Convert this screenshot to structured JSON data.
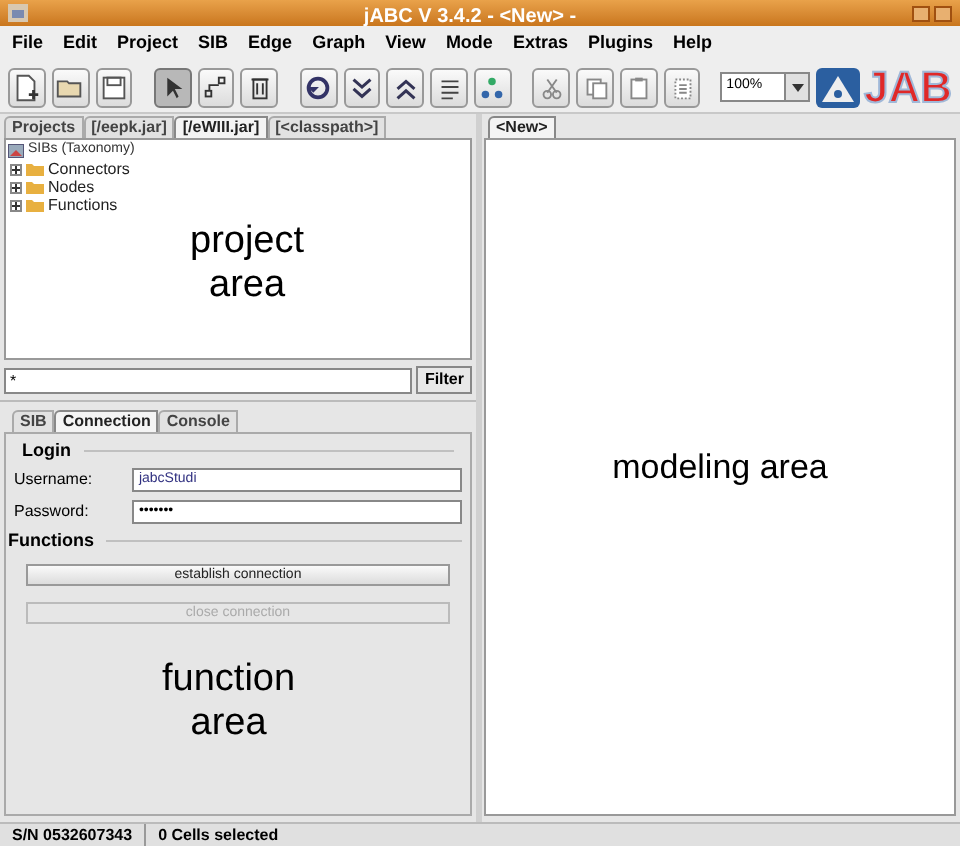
{
  "window": {
    "title": "jABC V 3.4.2 - <New> -"
  },
  "menu": [
    "File",
    "Edit",
    "Project",
    "SIB",
    "Edge",
    "Graph",
    "View",
    "Mode",
    "Extras",
    "Plugins",
    "Help"
  ],
  "toolbar": [
    {
      "kind": "new",
      "selected": false
    },
    {
      "kind": "open",
      "selected": false
    },
    {
      "kind": "save",
      "selected": false
    },
    {
      "kind": "gap"
    },
    {
      "kind": "pointer",
      "selected": true
    },
    {
      "kind": "edge",
      "selected": false
    },
    {
      "kind": "delete",
      "selected": false
    },
    {
      "kind": "gap"
    },
    {
      "kind": "refresh",
      "selected": false
    },
    {
      "kind": "down",
      "selected": false
    },
    {
      "kind": "up",
      "selected": false
    },
    {
      "kind": "align",
      "selected": false
    },
    {
      "kind": "tree",
      "selected": false
    },
    {
      "kind": "gap"
    },
    {
      "kind": "cut",
      "selected": false
    },
    {
      "kind": "copy",
      "selected": false
    },
    {
      "kind": "paste",
      "selected": false
    },
    {
      "kind": "paste2",
      "selected": false
    }
  ],
  "zoom": {
    "value": "100%"
  },
  "logo": {
    "text": "JAB"
  },
  "project_tabs": [
    {
      "label": "Projects",
      "selected": false
    },
    {
      "label": "[/eepk.jar]",
      "selected": false
    },
    {
      "label": "[/eWIII.jar]",
      "selected": true
    },
    {
      "label": "[<classpath>]",
      "selected": false
    }
  ],
  "tree": {
    "label": "SIBs (Taxonomy)",
    "children": [
      {
        "label": "Connectors",
        "expanded": false
      },
      {
        "label": "Nodes",
        "expanded": false
      },
      {
        "label": "Functions",
        "expanded": false
      }
    ]
  },
  "project_note": "project\narea",
  "filter": {
    "value": "*",
    "button": "Filter"
  },
  "function_tabs": [
    {
      "label": "SIB",
      "selected": false
    },
    {
      "label": "Connection",
      "selected": true
    },
    {
      "label": "Console",
      "selected": false
    }
  ],
  "login": {
    "heading": "Login",
    "username_label": "Username:",
    "username": "jabcStudi",
    "password_label": "Password:",
    "password": "•••••••"
  },
  "functions": {
    "heading": "Functions",
    "buttons": [
      {
        "label": "establish connection",
        "disabled": false
      },
      {
        "label": "close connection",
        "disabled": true
      }
    ]
  },
  "function_note": "function\narea",
  "editor_tabs": [
    {
      "label": "<New>",
      "selected": true
    }
  ],
  "modeling_note": "modeling area",
  "status_bar": [
    "S/N 0532607343",
    "0 Cells selected"
  ]
}
